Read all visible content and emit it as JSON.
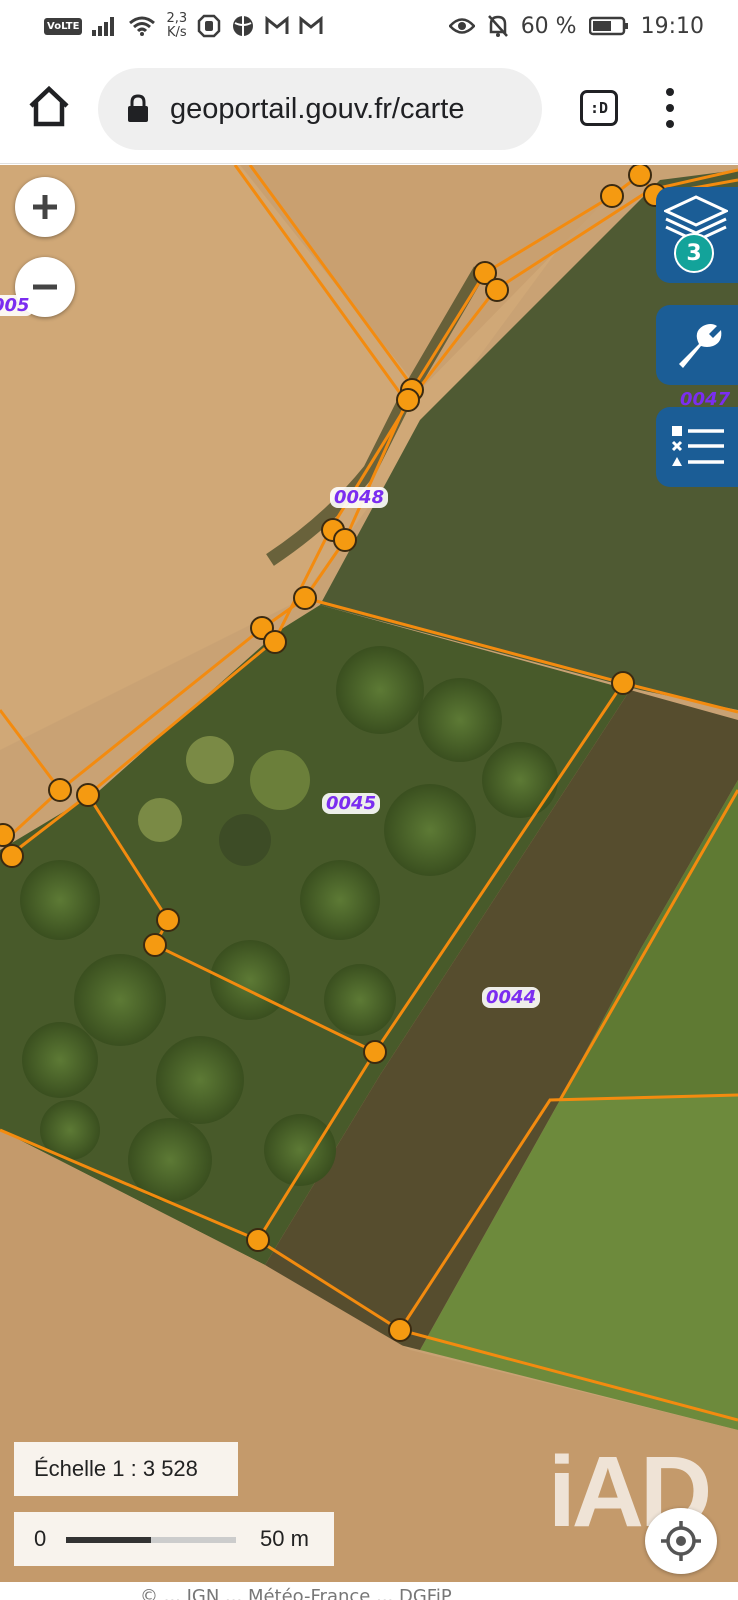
{
  "status_bar": {
    "network_badge": "VoLTE",
    "speed_value": "2,3",
    "speed_unit": "K/s",
    "battery": "60 %",
    "time": "19:10",
    "icons": [
      "volte-icon",
      "signal-icon",
      "wifi-icon",
      "hand-icon",
      "globe-icon",
      "gmail-icon",
      "gmail-icon",
      "eye-icon",
      "bell-off-icon",
      "battery-icon"
    ]
  },
  "browser": {
    "url": "geoportail.gouv.fr/carte",
    "tabs_label": ":D",
    "icons": [
      "home-icon",
      "lock-icon",
      "tabs-icon",
      "more-vert-icon"
    ]
  },
  "map": {
    "zoom_in_label": "+",
    "zoom_out_label": "−",
    "layers_count": "3",
    "parcels": [
      "0048",
      "0045",
      "0044",
      "005",
      "0047"
    ],
    "scale_ratio": "Échelle 1 : 3 528",
    "scale_zero": "0",
    "scale_distance": "50 m",
    "scale_bar_fill": 0.5,
    "watermark": "iAD",
    "colors": {
      "parcel_outline": "#f38b0f",
      "parcel_label": "#7b2df0",
      "side_button": "#1b5d96",
      "layer_badge": "#13a39a"
    }
  },
  "attribution": "© ... IGN ... Météo-France ... DGFiP"
}
